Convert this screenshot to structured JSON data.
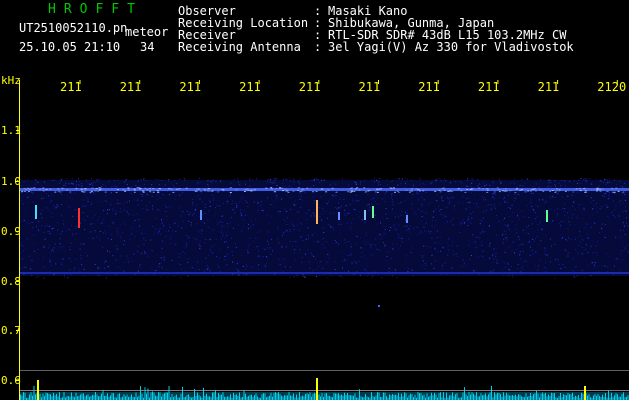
{
  "header": {
    "brand": "HROFFT",
    "filename": "UT2510052110.pn",
    "mode": "meteor",
    "datetime": "25.10.05 21:10",
    "duration": "34",
    "info": [
      {
        "label": "Observer",
        "value": "Masaki Kano"
      },
      {
        "label": "Receiving Location",
        "value": "Shibukawa, Gunma, Japan"
      },
      {
        "label": "Receiver",
        "value": "RTL-SDR SDR# 43dB L15 103.2MHz CW"
      },
      {
        "label": "Receiving Antenna",
        "value": "3el Yagi(V) Az 330 for Vladivostok"
      }
    ]
  },
  "axes": {
    "unit": "kHz",
    "y_ticks": [
      "1.1",
      "1.0",
      "0.9",
      "0.8",
      "0.7",
      "0.6"
    ],
    "x_ticks": [
      "211",
      "211",
      "211",
      "211",
      "211",
      "211",
      "211",
      "211",
      "211",
      "2120"
    ]
  },
  "colors": {
    "background": "#000000",
    "brand": "#00c800",
    "axis_text": "#ffff00",
    "noise_band": "#1a2cff",
    "carrier": "#9fb8ff",
    "audio_trace": "#00e0ff"
  }
}
